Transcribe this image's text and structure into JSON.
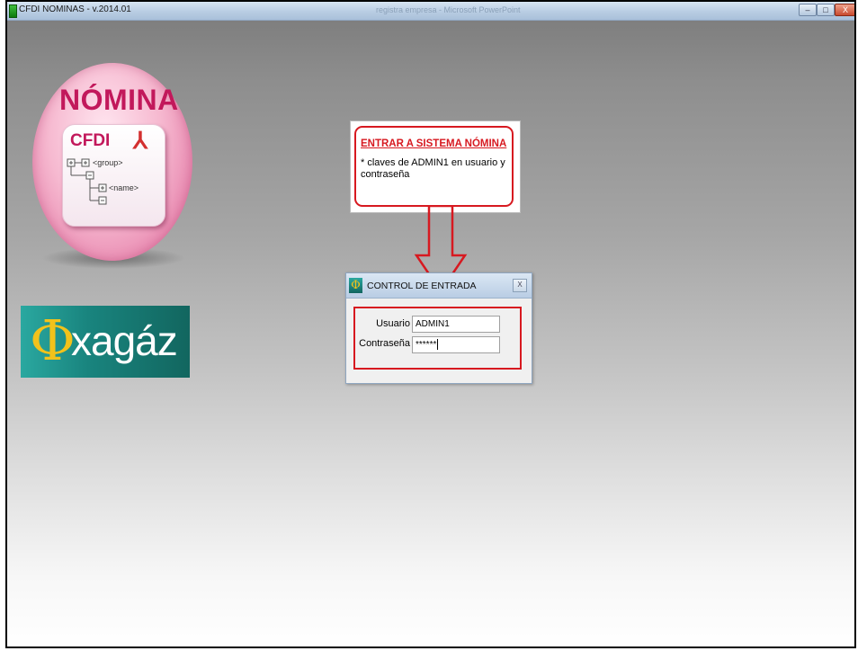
{
  "window": {
    "title": "CFDI NOMINAS - v.2014.01",
    "background_title": "registra empresa - Microsoft PowerPoint",
    "controls": {
      "minimize": "–",
      "maximize": "□",
      "close": "X"
    }
  },
  "nomina_logo": {
    "title": "NÓMINA",
    "subtitle": "CFDI",
    "tree_items": [
      "<group>",
      "<name>"
    ],
    "pdf_icon": "pdf-icon"
  },
  "xagaz_logo": {
    "symbol": "Φ",
    "text": "xagaz"
  },
  "callout": {
    "title": "ENTRAR A SISTEMA NÓMINA",
    "body": "* claves de ADMIN1 en usuario y contraseña"
  },
  "dialog": {
    "title": "CONTROL DE ENTRADA",
    "close_label": "X",
    "user_label": "Usuario",
    "user_value": "ADMIN1",
    "password_label": "Contraseña",
    "password_value": "******"
  },
  "colors": {
    "accent_red": "#d71920",
    "brand_pink": "#c2185b",
    "brand_teal": "#19847e",
    "brand_gold": "#f2c21b"
  }
}
